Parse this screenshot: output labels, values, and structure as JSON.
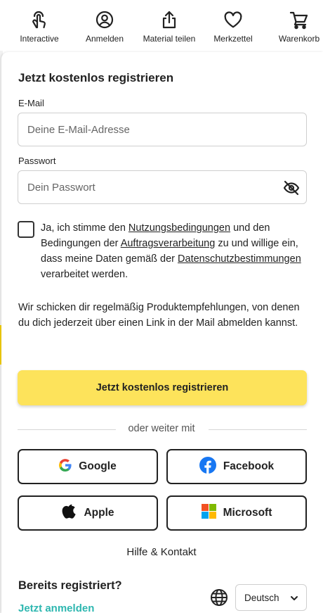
{
  "nav": {
    "items": [
      {
        "label": "Interactive",
        "icon": "touch-hand-icon"
      },
      {
        "label": "Anmelden",
        "icon": "user-circle-icon"
      },
      {
        "label": "Material teilen",
        "icon": "share-upload-icon"
      },
      {
        "label": "Merkzettel",
        "icon": "heart-icon"
      },
      {
        "label": "Warenkorb",
        "icon": "cart-icon"
      }
    ]
  },
  "register": {
    "title": "Jetzt kostenlos registrieren",
    "email_label": "E-Mail",
    "email_placeholder": "Deine E-Mail-Adresse",
    "email_value": "",
    "password_label": "Passwort",
    "password_placeholder": "Dein Passwort",
    "password_value": "",
    "consent": {
      "checked": false,
      "part1": "Ja, ich stimme den ",
      "link1": "Nutzungsbedingungen",
      "part2": " und den Bedingungen der ",
      "link2": "Auftragsverarbeitung",
      "part3": " zu und willige ein, dass meine Daten gemäß der ",
      "link3": "Datenschutzbestimmungen",
      "part4": " verarbeitet werden."
    },
    "info_text": "Wir schicken dir regelmäßig Produktempfehlungen, von denen du dich jederzeit über einen Link in der Mail abmelden kannst.",
    "submit_label": "Jetzt kostenlos registrieren",
    "divider_text": "oder weiter mit"
  },
  "social": {
    "google": "Google",
    "facebook": "Facebook",
    "apple": "Apple",
    "microsoft": "Microsoft"
  },
  "footer": {
    "help": "Hilfe & Kontakt",
    "already_registered": "Bereits registriert?",
    "login_link": "Jetzt anmelden",
    "language": "Deutsch"
  },
  "colors": {
    "accent_yellow": "#fde35b",
    "link_teal": "#2eb7b0",
    "facebook_blue": "#1877f2"
  }
}
